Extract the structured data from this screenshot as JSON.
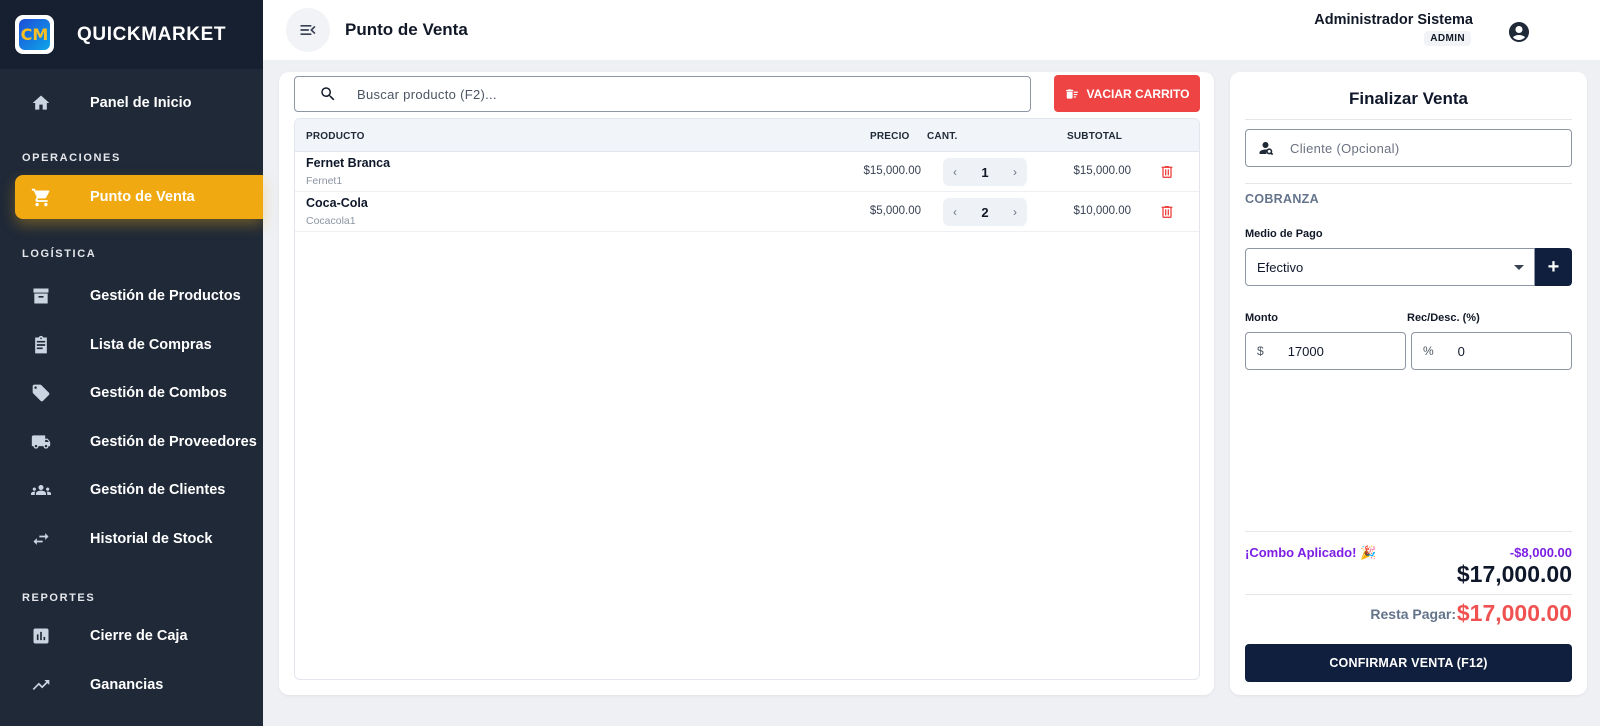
{
  "brand": {
    "name": "QUICKMARKET",
    "logo_text": "CM"
  },
  "sidebar": {
    "items": [
      {
        "label": "Panel de Inicio",
        "icon": "home-icon"
      },
      {
        "label": "Punto de Venta",
        "icon": "cart-icon",
        "active": true
      },
      {
        "label": "Gestión de Productos",
        "icon": "archive-icon"
      },
      {
        "label": "Lista de Compras",
        "icon": "clipboard-icon"
      },
      {
        "label": "Gestión de Combos",
        "icon": "tag-icon"
      },
      {
        "label": "Gestión de Proveedores",
        "icon": "truck-icon"
      },
      {
        "label": "Gestión de Clientes",
        "icon": "people-icon"
      },
      {
        "label": "Historial de Stock",
        "icon": "swap-icon"
      },
      {
        "label": "Cierre de Caja",
        "icon": "bar-chart-icon"
      },
      {
        "label": "Ganancias",
        "icon": "trending-up-icon"
      }
    ],
    "sections": {
      "operaciones": "OPERACIONES",
      "logistica": "LOGÍSTICA",
      "reportes": "REPORTES"
    }
  },
  "header": {
    "title": "Punto de Venta",
    "user_name": "Administrador Sistema",
    "user_role": "ADMIN"
  },
  "cart": {
    "search_placeholder": "Buscar producto (F2)...",
    "clear_button": "VACIAR CARRITO",
    "columns": {
      "product": "PRODUCTO",
      "price": "PRECIO",
      "qty": "CANT.",
      "subtotal": "SUBTOTAL"
    },
    "rows": [
      {
        "name": "Fernet Branca",
        "code": "Fernet1",
        "price": "$15,000.00",
        "qty": "1",
        "subtotal": "$15,000.00"
      },
      {
        "name": "Coca-Cola",
        "code": "Cocacola1",
        "price": "$5,000.00",
        "qty": "2",
        "subtotal": "$10,000.00"
      }
    ]
  },
  "checkout": {
    "title": "Finalizar Venta",
    "client_placeholder": "Cliente (Opcional)",
    "section_label": "COBRANZA",
    "payment_method_label": "Medio de Pago",
    "payment_method_value": "Efectivo",
    "amount_label": "Monto",
    "amount_prefix": "$",
    "amount_value": "17000",
    "adjust_label": "Rec/Desc. (%)",
    "adjust_prefix": "%",
    "adjust_value": "0",
    "combo_label": "¡Combo Aplicado! 🎉",
    "combo_value": "-$8,000.00",
    "total": "$17,000.00",
    "remaining_label": "Resta Pagar:",
    "remaining_value": "$17,000.00",
    "confirm_button": "CONFIRMAR VENTA (F12)"
  },
  "colors": {
    "sidebar_bg": "#1f2937",
    "active": "#f0a911",
    "danger": "#ef4444",
    "primary": "#0f1f3d",
    "combo": "#7c1ee3"
  }
}
